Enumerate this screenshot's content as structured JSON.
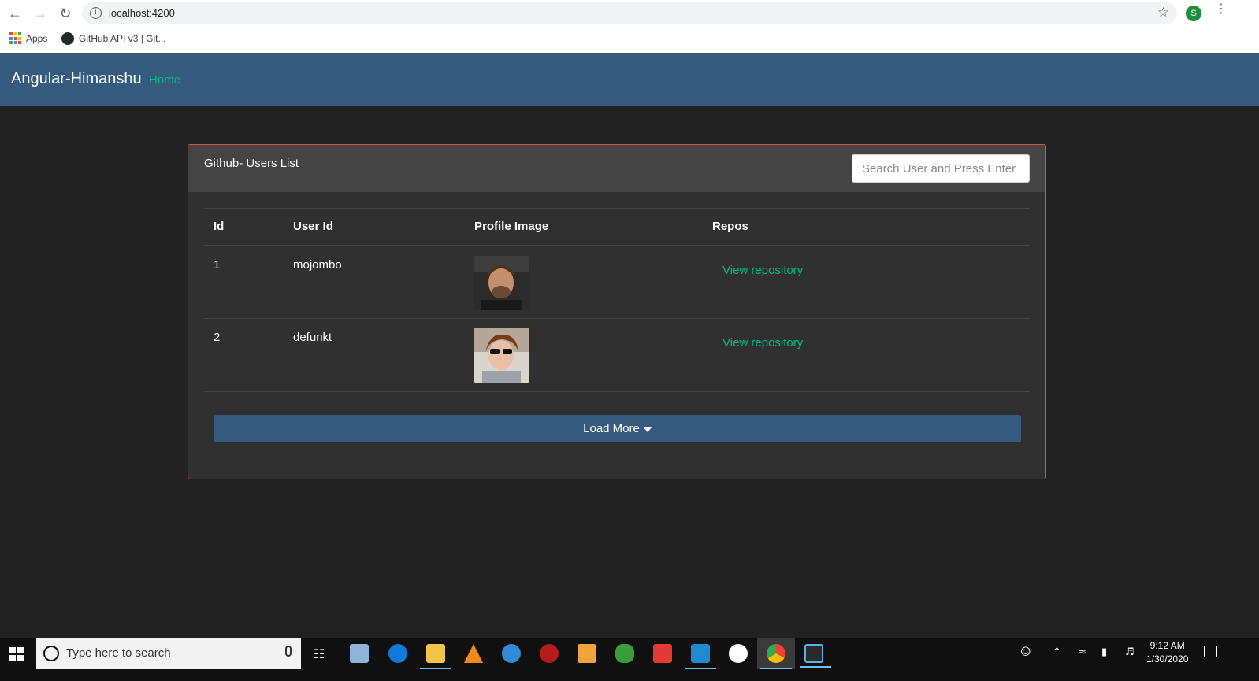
{
  "browser": {
    "url": "localhost:4200",
    "profile_initial": "S",
    "bookmarks": [
      {
        "label": "Apps"
      },
      {
        "label": "GitHub API v3 | Git..."
      }
    ]
  },
  "navbar": {
    "brand": "Angular-Himanshu",
    "home_link": "Home",
    "bg_color": "#375a7f",
    "link_color": "#00bc8c"
  },
  "card": {
    "title": "Github- Users List",
    "search_placeholder": "Search User and Press Enter",
    "border_color": "#e74c3c"
  },
  "table": {
    "headers": [
      "Id",
      "User Id",
      "Profile Image",
      "Repos"
    ],
    "rows": [
      {
        "id": "1",
        "user_id": "mojombo",
        "repo_link": "View repository"
      },
      {
        "id": "2",
        "user_id": "defunkt",
        "repo_link": "View repository"
      }
    ]
  },
  "load_more": {
    "label": "Load More"
  },
  "taskbar": {
    "search_placeholder": "Type here to search",
    "time": "9:12 AM",
    "date": "1/30/2020",
    "apps": [
      "file-viewer",
      "edge",
      "file-explorer",
      "vlc",
      "thunderbird",
      "screen-recorder",
      "livewriter",
      "shield-app",
      "anydesk",
      "vscode",
      "mongodb-compass",
      "chrome",
      "editor"
    ]
  }
}
